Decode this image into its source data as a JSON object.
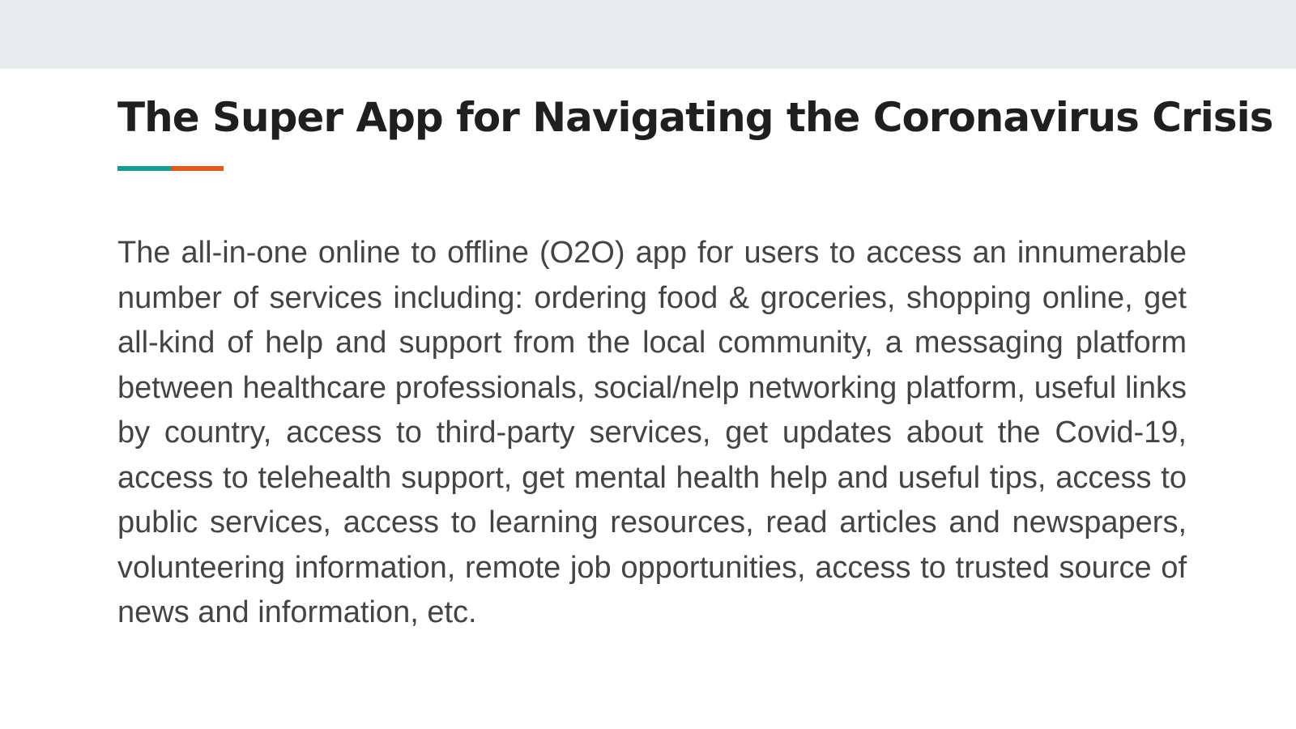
{
  "header": {
    "title": "The Super App for Navigating the Coronavirus Crisis"
  },
  "underline": {
    "left_color": "#1a9a8c",
    "right_color": "#e35b1a"
  },
  "colors": {
    "top_band": "#e9eced",
    "title": "#1f1f1f",
    "body_text": "#444444"
  },
  "main": {
    "description": "The all-in-one online to offline (O2O) app for users to access an innumerable number of services including: ordering food & groceries, shopping online, get all-kind of help and support from the local community, a messaging platform between healthcare professionals, social/nelp networking platform, useful links by country,  access to third-party services, get updates about the Covid-19, access to telehealth support, get mental health help and useful tips, access to public services, access to learning resources, read articles and newspapers, volunteering information, remote job opportunities, access to trusted source of news and information, etc."
  }
}
